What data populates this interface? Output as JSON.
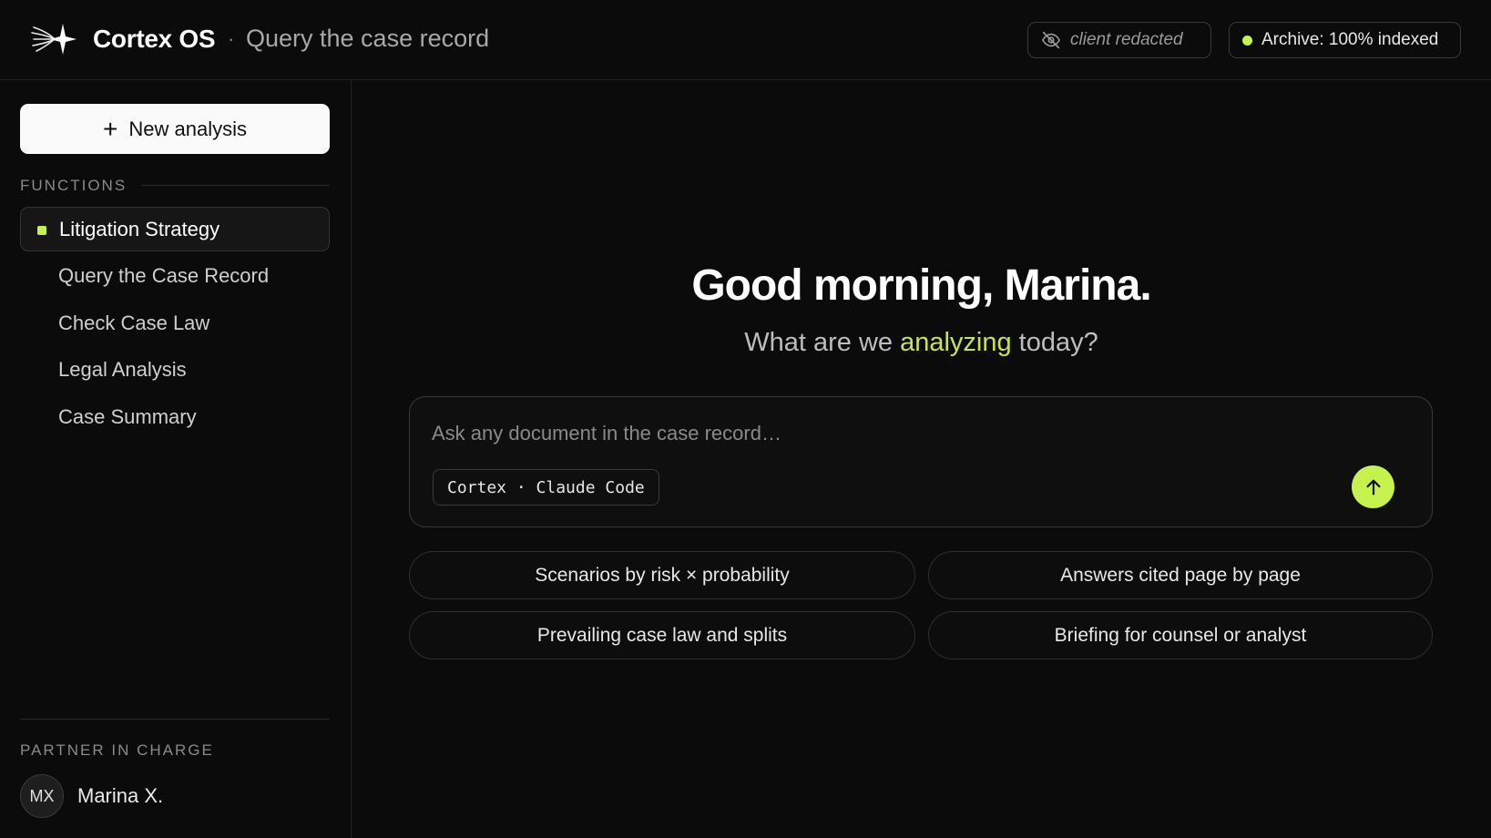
{
  "header": {
    "brand": "Cortex OS",
    "separator": "·",
    "context": "Query the case record",
    "redacted_pill": "client redacted",
    "archive_pill": "Archive: 100% indexed",
    "archive_status_color": "#c6f24e"
  },
  "sidebar": {
    "new_button": {
      "icon": "plus-icon",
      "label": "New analysis"
    },
    "functions_label": "FUNCTIONS",
    "items": [
      {
        "label": "Litigation Strategy",
        "active": true
      },
      {
        "label": "Query the Case Record",
        "active": false
      },
      {
        "label": "Check Case Law",
        "active": false
      },
      {
        "label": "Legal Analysis",
        "active": false
      },
      {
        "label": "Case Summary",
        "active": false
      }
    ],
    "partner_label": "PARTNER IN CHARGE",
    "partner": {
      "initials": "MX",
      "name": "Marina X."
    }
  },
  "main": {
    "greeting": "Good morning, Marina.",
    "sub_before": "What are we ",
    "sub_accent": "analyzing",
    "sub_after": " today?",
    "composer": {
      "placeholder": "Ask any document in the case record…",
      "model_tag": "Cortex · Claude Code",
      "send_icon": "arrow-up-icon"
    },
    "suggestions": [
      "Scenarios by risk × probability",
      "Answers cited page by page",
      "Prevailing case law and splits",
      "Briefing for counsel or analyst"
    ]
  },
  "colors": {
    "accent": "#c6f24e",
    "background": "#0b0b0b"
  }
}
